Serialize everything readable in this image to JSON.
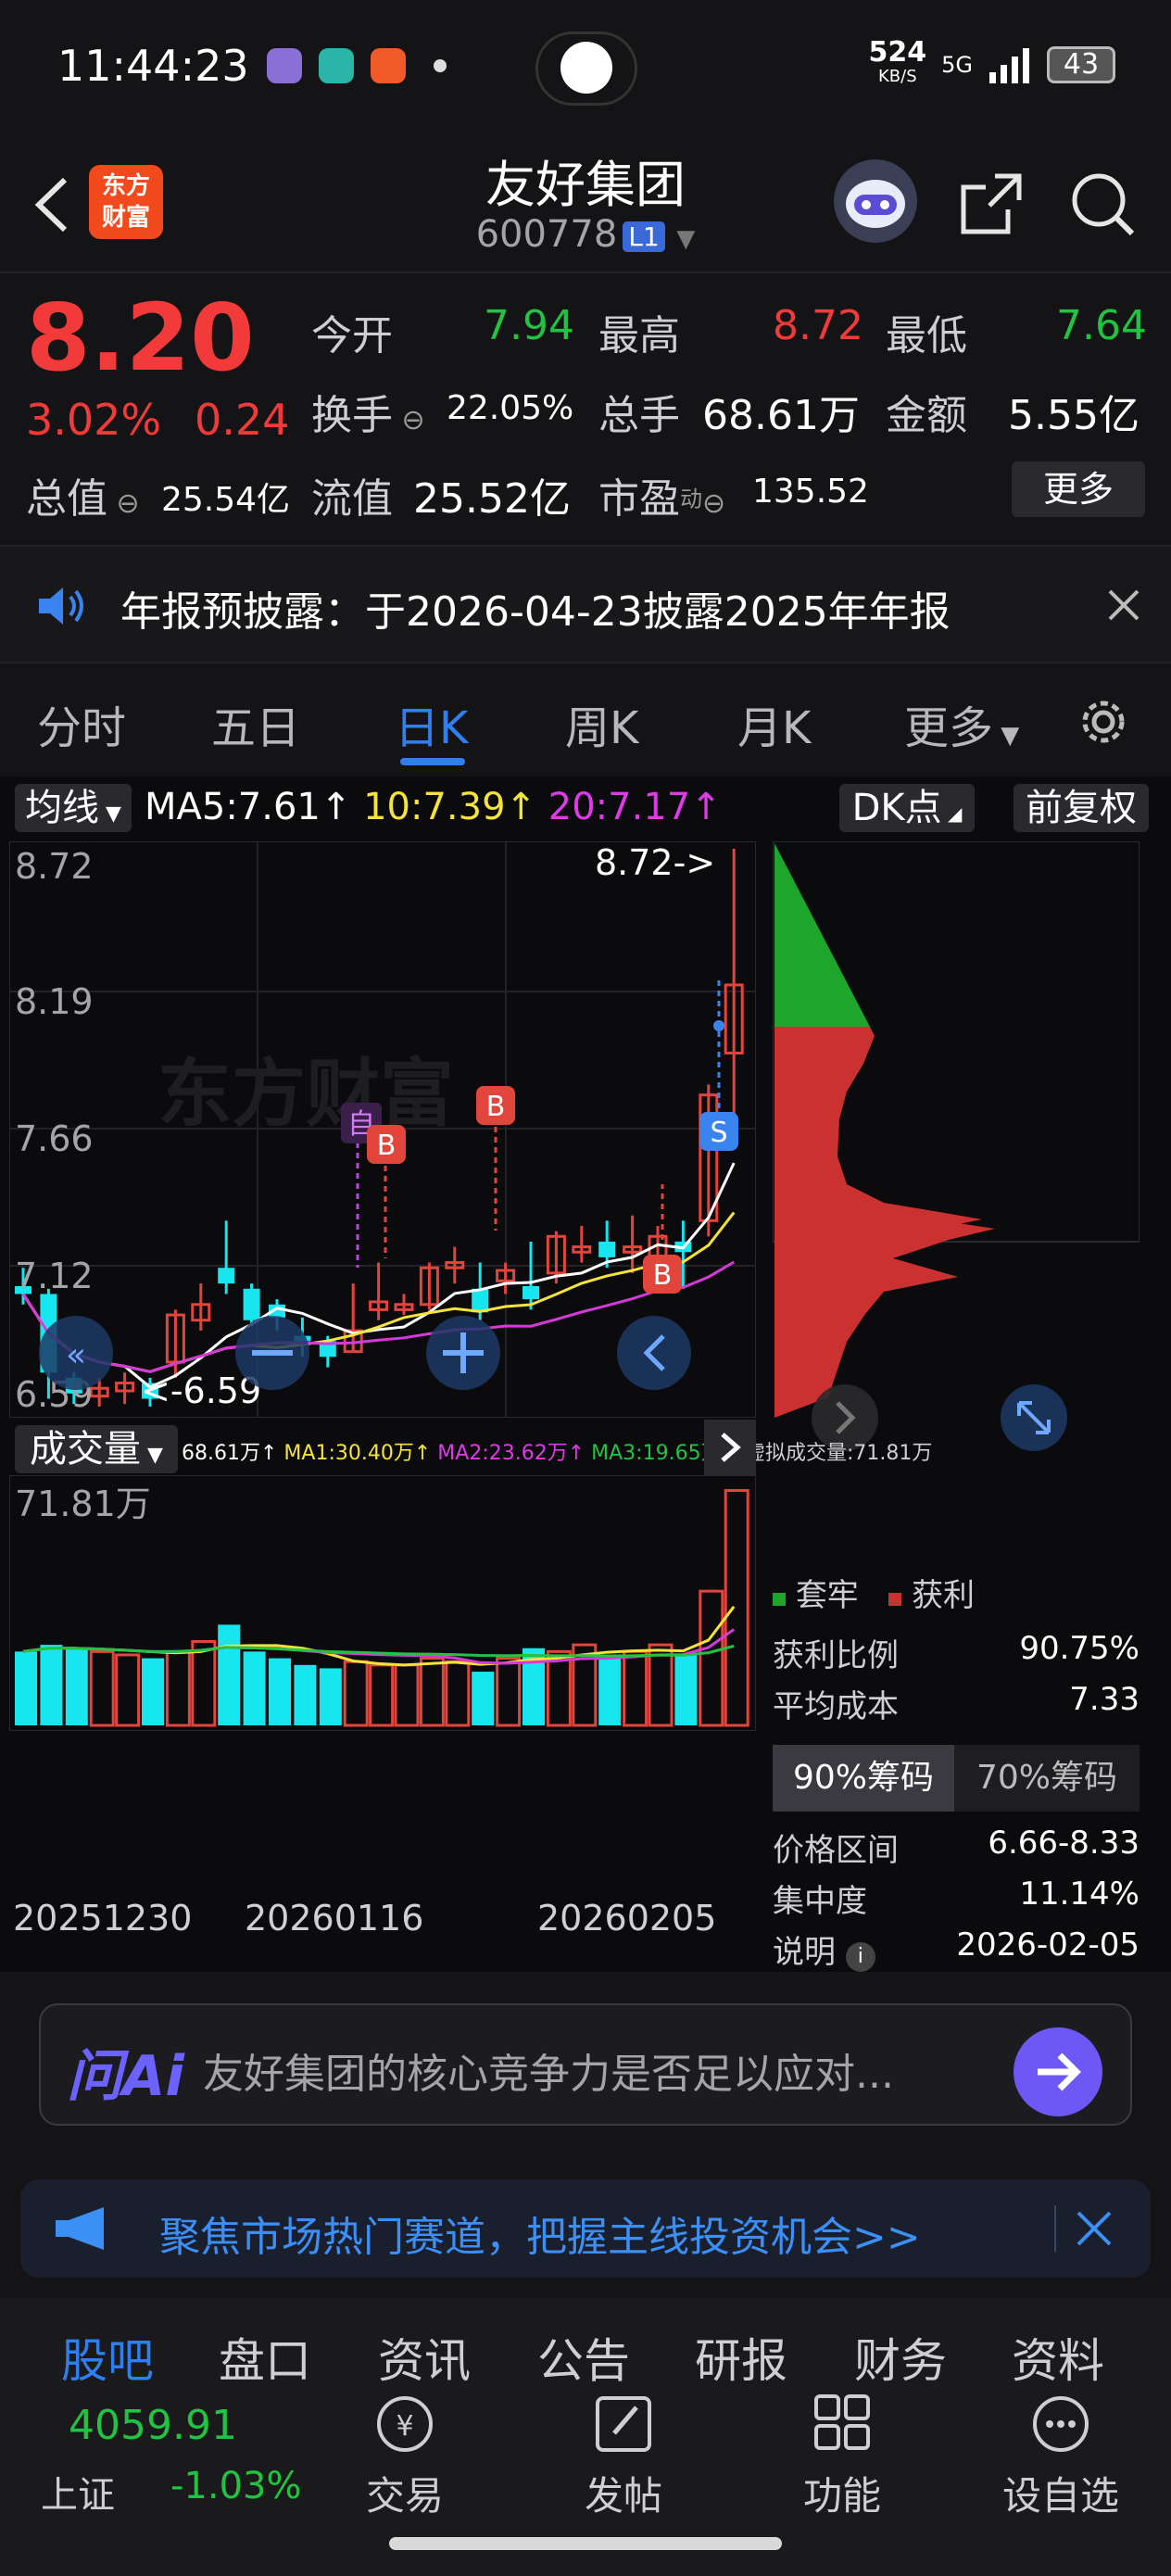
{
  "status": {
    "time": "11:44:23",
    "speed": "524",
    "speed_unit": "KB/S",
    "network": "5G",
    "battery": "43"
  },
  "header": {
    "brand_logo": "东方\n财富",
    "stock_name": "友好集团",
    "stock_code": "600778",
    "level_badge": "L1"
  },
  "quote": {
    "price": "8.20",
    "change_pct": "3.02%",
    "change": "0.24",
    "open_label": "今开",
    "open": "7.94",
    "high_label": "最高",
    "high": "8.72",
    "low_label": "最低",
    "low": "7.64",
    "turnover_label": "换手",
    "turnover": "22.05%",
    "volume_label": "总手",
    "volume": "68.61万",
    "amount_label": "金额",
    "amount": "5.55亿",
    "mktcap_label": "总值",
    "mktcap": "25.54亿",
    "float_label": "流值",
    "float": "25.52亿",
    "pe_label": "市盈",
    "pe_sup": "动",
    "pe": "135.52",
    "more_btn": "更多"
  },
  "notice": {
    "text": "年报预披露：于2026-04-23披露2025年年报"
  },
  "tabs": [
    "分时",
    "五日",
    "日K",
    "周K",
    "月K",
    "更多"
  ],
  "active_tab": "日K",
  "chart": {
    "ma_selector": "均线",
    "ma5": "MA5:7.61↑",
    "ma10": "10:7.39↑",
    "ma20": "20:7.17↑",
    "dk_button": "DK点",
    "adjust_button": "前复权",
    "y_labels": [
      "8.72",
      "8.19",
      "7.66",
      "7.12",
      "6.59"
    ],
    "high_marker": "8.72->",
    "low_marker": "<-6.59",
    "watermark": "东方财富",
    "marker_self": "自",
    "marker_b": "B",
    "marker_s": "S",
    "vol_selector": "成交量",
    "vol_legend": {
      "total": "68.61万↑",
      "ma1": "MA1:30.40万↑",
      "ma2": "MA2:23.62万↑",
      "ma3": "MA3:19.65万↑",
      "virtual": "虚拟成交量:71.81万"
    },
    "vol_max": "71.81万",
    "dates": [
      "20251230",
      "20260116",
      "20260205"
    ]
  },
  "chip": {
    "legend_trapped": "套牢",
    "legend_profit": "获利",
    "profit_ratio_label": "获利比例",
    "profit_ratio": "90.75%",
    "avg_cost_label": "平均成本",
    "avg_cost": "7.33",
    "tab90": "90%筹码",
    "tab70": "70%筹码",
    "range_label": "价格区间",
    "range": "6.66-8.33",
    "concentration_label": "集中度",
    "concentration": "11.14%",
    "note_label": "说明",
    "note": "2026-02-05"
  },
  "ai": {
    "logo": "问Ai",
    "prompt": "友好集团的核心竞争力是否足以应对..."
  },
  "promo": {
    "text": "聚焦市场热门赛道，把握主线投资机会>>"
  },
  "bottom_tabs": [
    "股吧",
    "盘口",
    "资讯",
    "公告",
    "研报",
    "财务",
    "资料"
  ],
  "index": {
    "value": "4059.91",
    "name": "上证",
    "pct": "-1.03%"
  },
  "bottom_nav": [
    "交易",
    "发帖",
    "功能",
    "设自选"
  ],
  "colors": {
    "up": "#f23a3a",
    "down": "#21c442",
    "accent": "#2f7ff0",
    "cyan": "#17e6ee"
  }
}
